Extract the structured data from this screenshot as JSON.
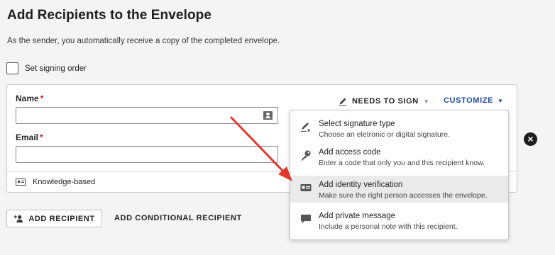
{
  "page": {
    "title": "Add Recipients to the Envelope",
    "subtitle": "As the sender, you automatically receive a copy of the completed envelope."
  },
  "signing_order": {
    "label": "Set signing order",
    "checked": false
  },
  "recipient_card": {
    "name_label": "Name",
    "email_label": "Email",
    "required_mark": "*",
    "name_value": "",
    "email_value": "",
    "action_label": "NEEDS TO SIGN",
    "customize_label": "CUSTOMIZE",
    "auth_method": "Knowledge-based"
  },
  "customize_menu": {
    "items": [
      {
        "title": "Select signature type",
        "description": "Choose an eletronic or digital signature.",
        "icon": "pen-icon",
        "highlighted": false
      },
      {
        "title": "Add access code",
        "description": "Enter a code that only you and this recipient know.",
        "icon": "key-icon",
        "highlighted": false
      },
      {
        "title": "Add identity verification",
        "description": "Make sure the right person accesses the envelope.",
        "icon": "id-card-icon",
        "highlighted": true
      },
      {
        "title": "Add private message",
        "description": "Include a personal note with this recipient.",
        "icon": "speech-bubble-icon",
        "highlighted": false
      }
    ]
  },
  "actions": {
    "add_recipient": "ADD RECIPIENT",
    "add_conditional": "ADD CONDITIONAL RECIPIENT"
  },
  "colors": {
    "accent_blue": "#1d4aa0",
    "required_red": "#c8102e",
    "annotation_arrow": "#e03a2f",
    "highlight_bg": "#eaeaea"
  }
}
